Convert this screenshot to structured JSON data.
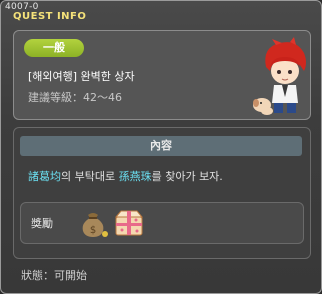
{
  "window": {
    "quest_id": "4007-0",
    "title": "QUEST INFO"
  },
  "quest": {
    "category": "一般",
    "name": "[해외여행] 완벽한 상자",
    "level_label": "建議等級",
    "level_range": "42～46"
  },
  "content": {
    "header": "內容",
    "npc_from": "諸葛均",
    "text_mid": "의 부탁대로 ",
    "npc_to": "孫燕珠",
    "text_end": "를 찾아가 보자."
  },
  "reward": {
    "label": "獎勵",
    "items": [
      {
        "icon": "money-bag-icon"
      },
      {
        "icon": "gift-box-icon"
      }
    ]
  },
  "status": {
    "label": "狀態",
    "value": "可開始"
  }
}
